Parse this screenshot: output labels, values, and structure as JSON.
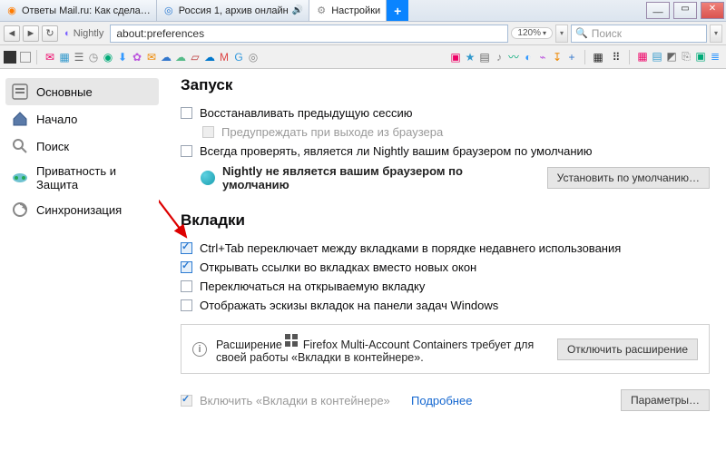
{
  "tabs": [
    {
      "favcolor": "#ff7b00",
      "label": "Ответы Mail.ru: Как сдела…"
    },
    {
      "favcolor": "#2a7ad2",
      "label": "Россия 1, архив онлайн",
      "audio": true
    },
    {
      "favcolor": "#888",
      "label": "Настройки"
    }
  ],
  "newtab_glyph": "+",
  "window": {
    "min": "__",
    "max": "▭",
    "close": "✕"
  },
  "nav": {
    "back": "◄",
    "fwd": "►",
    "reload": "↻",
    "identity": "Nightly"
  },
  "url": "about:preferences",
  "zoom": "120%",
  "search_placeholder": "Поиск",
  "toolbar_glyphs_left": [
    "✉",
    "▦",
    "☰",
    "◷",
    "◉",
    "⬇",
    "✿",
    "✉",
    "☁",
    "☁",
    "▱",
    "☁",
    "M",
    "G",
    "◎"
  ],
  "toolbar_glyphs_mid": [
    "▣",
    "★",
    "▤",
    "♪",
    "〰",
    "◐",
    "⌁",
    "↧",
    "+"
  ],
  "toolbar_glyphs_right": [
    "▦",
    "▤",
    "◩",
    "⎘",
    "▣",
    "≣"
  ],
  "sidebar": [
    {
      "icon": "general",
      "label": "Основные",
      "active": true
    },
    {
      "icon": "home",
      "label": "Начало"
    },
    {
      "icon": "search",
      "label": "Поиск"
    },
    {
      "icon": "privacy",
      "label": "Приватность и Защита"
    },
    {
      "icon": "sync",
      "label": "Синхронизация"
    }
  ],
  "sections": {
    "startup": {
      "title": "Запуск",
      "restore": "Восстанавливать предыдущую сессию",
      "warn": "Предупреждать при выходе из браузера",
      "always_check": "Всегда проверять, является ли Nightly вашим браузером по умолчанию",
      "status": "Nightly не является вашим браузером по умолчанию",
      "set_default_btn": "Установить по умолчанию…"
    },
    "tabs": {
      "title": "Вкладки",
      "ctrltab": "Ctrl+Tab переключает между вкладками в порядке недавнего использования",
      "open_in_tabs": "Открывать ссылки во вкладках вместо новых окон",
      "switch": "Переключаться на открываемую вкладку",
      "thumbs": "Отображать эскизы вкладок на панели задач Windows",
      "ext_text_a": "Расширение ",
      "ext_name": "Firefox Multi-Account Containers",
      "ext_text_b": " требует для своей работы «Вкладки в контейнере».",
      "disable_ext": "Отключить расширение",
      "enable_containers": "Включить «Вкладки в контейнере»",
      "learn_more": "Подробнее",
      "params_btn": "Параметры…"
    }
  }
}
